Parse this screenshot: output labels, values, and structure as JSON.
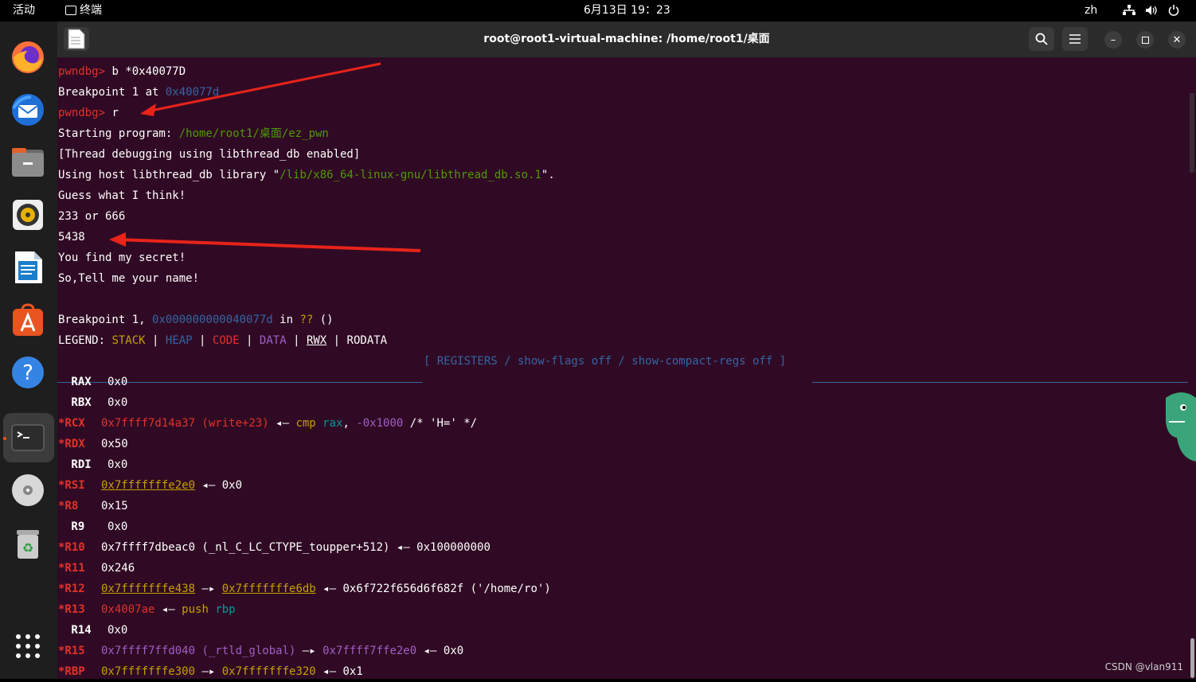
{
  "topbar": {
    "activities": "活动",
    "app_name": "终端",
    "datetime": "6月13日 19：23",
    "lang": "zh"
  },
  "window": {
    "title": "root@root1-virtual-machine: /home/root1/桌面"
  },
  "terminal": {
    "prompt": "pwndbg>",
    "cmd1": " b *0x40077D",
    "bp_text": "Breakpoint 1 at ",
    "bp_addr": "0x40077d",
    "cmd2": " r",
    "start_text": "Starting program: ",
    "start_path": "/home/root1/桌面/ez_pwn",
    "thread_line": "[Thread debugging using libthread_db enabled]",
    "host_pre": "Using host libthread_db library \"",
    "host_path": "/lib/x86_64-linux-gnu/libthread_db.so.1",
    "host_post": "\".",
    "guess": "Guess what I think!",
    "options": "233 or 666",
    "input": "5438",
    "secret": "You find my secret!",
    "tellname": "So,Tell me your name!",
    "bp1_pre": "Breakpoint 1, ",
    "bp1_addr": "0x000000000040077d",
    "bp1_in": " in ",
    "bp1_q": "??",
    "bp1_post": " ()",
    "legend_label": "LEGEND: ",
    "legend_stack": "STACK",
    "legend_heap": "HEAP",
    "legend_code": "CODE",
    "legend_data": "DATA",
    "legend_rwx": "RWX",
    "legend_rodata": "RODATA",
    "legend_sep": " | ",
    "registers_header": "[ REGISTERS / show-flags off / show-compact-regs off ]"
  },
  "registers": {
    "rax": {
      "name": " RAX",
      "val": "0x0"
    },
    "rbx": {
      "name": " RBX",
      "val": "0x0"
    },
    "rcx": {
      "name": "*RCX",
      "val": "0x7ffff7d14a37 (write+23)",
      "arrow": " ◂— ",
      "op": "cmp",
      "a1": "rax",
      "comma": ", ",
      "a2": "-0x1000",
      "comment": " /* 'H=' */"
    },
    "rdx": {
      "name": "*RDX",
      "val": "0x50"
    },
    "rdi": {
      "name": " RDI",
      "val": "0x0"
    },
    "rsi": {
      "name": "*RSI",
      "val": "0x7fffffffe2e0",
      "arrow": " ◂— ",
      "tail": "0x0"
    },
    "r8": {
      "name": "*R8",
      "val": "0x15"
    },
    "r9": {
      "name": " R9",
      "val": "0x0"
    },
    "r10": {
      "name": "*R10",
      "val": "0x7ffff7dbeac0 (_nl_C_LC_CTYPE_toupper+512)",
      "arrow": " ◂— ",
      "tail": "0x100000000"
    },
    "r11": {
      "name": "*R11",
      "val": "0x246"
    },
    "r12": {
      "name": "*R12",
      "val": "0x7fffffffe438",
      "arrow1": " —▸ ",
      "val2": "0x7fffffffe6db",
      "arrow2": " ◂— ",
      "tail": "0x6f722f656d6f682f ('/home/ro')"
    },
    "r13": {
      "name": "*R13",
      "val": "0x4007ae",
      "arrow": " ◂— ",
      "op": "push",
      "a1": "rbp"
    },
    "r14": {
      "name": " R14",
      "val": "0x0"
    },
    "r15": {
      "name": "*R15",
      "val": "0x7ffff7ffd040 (_rtld_global)",
      "arrow1": " —▸ ",
      "val2": "0x7ffff7ffe2e0",
      "arrow2": " ◂— ",
      "tail": "0x0"
    },
    "rbp": {
      "name": "*RBP",
      "val": "0x7fffffffe300",
      "arrow1": " —▸ ",
      "val2": "0x7fffffffe320",
      "arrow2": " ◂— ",
      "tail": "0x1"
    }
  },
  "watermark": "CSDN @vlan911"
}
